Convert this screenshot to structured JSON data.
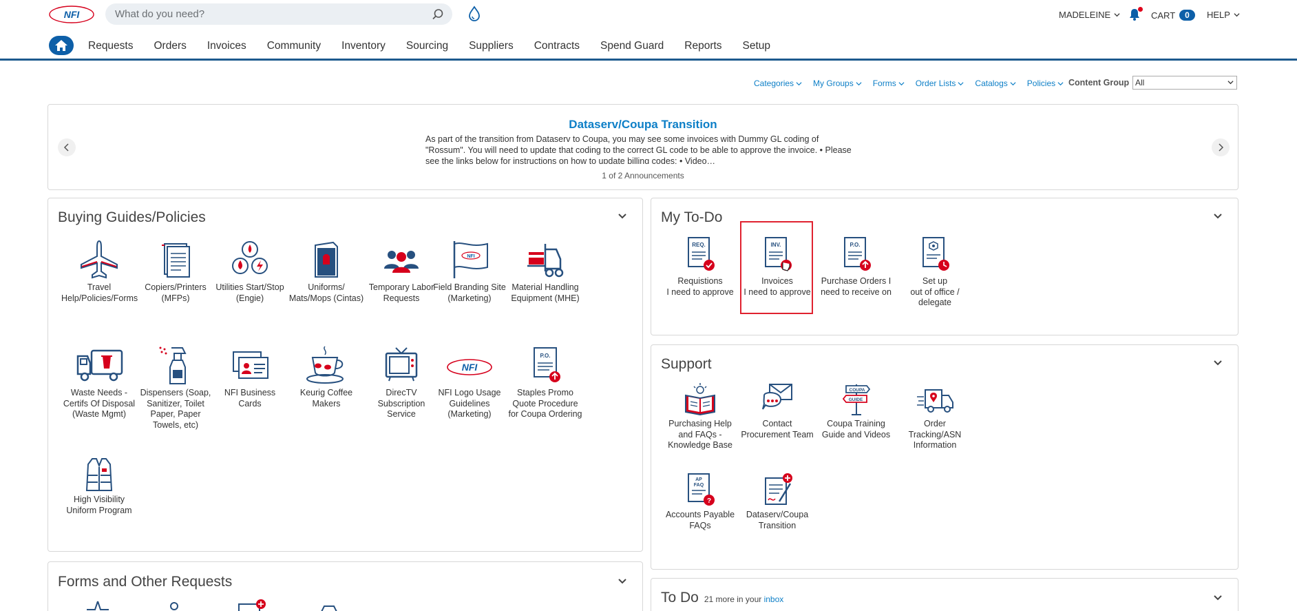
{
  "header": {
    "logo_text": "NFI",
    "search_placeholder": "What do you need?",
    "user_label": "MADELEINE",
    "cart_label": "CART",
    "cart_count": "0",
    "help_label": "HELP"
  },
  "nav": {
    "items": [
      "Requests",
      "Orders",
      "Invoices",
      "Community",
      "Inventory",
      "Sourcing",
      "Suppliers",
      "Contracts",
      "Spend Guard",
      "Reports",
      "Setup"
    ]
  },
  "subnav": {
    "items": [
      "Categories",
      "My Groups",
      "Forms",
      "Order Lists",
      "Catalogs",
      "Policies"
    ],
    "content_group_label": "Content Group",
    "content_group_value": "All"
  },
  "announcement": {
    "title": "Dataserv/Coupa Transition",
    "body": "As part of the transition from Dataserv to Coupa, you may see some invoices with Dummy GL coding of \"Rossum\". You will need to update that coding to the correct GL code to be able to approve the invoice. • Please see the links below for instructions on how to update billing codes: • Video…",
    "counter": "1 of 2 Announcements"
  },
  "buying_guides": {
    "title": "Buying Guides/Policies",
    "tiles": [
      "Travel Help/Policies/Forms",
      "Copiers/Printers (MFPs)",
      "Utilities Start/Stop (Engie)",
      "Uniforms/ Mats/Mops (Cintas)",
      "Temporary Labor Requests",
      "Field Branding Site (Marketing)",
      "Material Handling Equipment (MHE)",
      "Waste Needs - Certifs Of Disposal (Waste Mgmt)",
      "Dispensers (Soap, Sanitizer, Toilet Paper, Paper Towels, etc)",
      "NFI Business Cards",
      "Keurig Coffee Makers",
      "DirecTV Subscription Service",
      "NFI Logo Usage Guidelines (Marketing)",
      "Staples Promo Quote Procedure for Coupa Ordering",
      "High Visibility Uniform Program"
    ]
  },
  "my_todo": {
    "title": "My To-Do",
    "tiles": [
      {
        "label_1": "Requistions",
        "label_2": "I need to approve",
        "doc_text": "REQ."
      },
      {
        "label_1": "Invoices",
        "label_2": "I need to approve",
        "doc_text": "INV."
      },
      {
        "label_1": "Purchase Orders I",
        "label_2": "need to receive on",
        "doc_text": "P.O."
      },
      {
        "label_1": "Set up",
        "label_2": "out of office / delegate",
        "doc_text": ""
      }
    ]
  },
  "support": {
    "title": "Support",
    "tiles": [
      "Purchasing Help and FAQs - Knowledge Base",
      "Contact Procurement Team",
      "Coupa Training Guide and Videos",
      "Order Tracking/ASN Information",
      "Accounts Payable FAQs",
      "Dataserv/Coupa Transition"
    ],
    "guide_sign_top": "COUPA",
    "guide_sign_bottom": "GUIDE",
    "ap_doc_text_1": "AP",
    "ap_doc_text_2": "FAQ"
  },
  "forms": {
    "title": "Forms and Other Requests"
  },
  "todo": {
    "title": "To Do",
    "more_text": "21 more in your",
    "inbox_link": "inbox"
  },
  "colors": {
    "brand_blue": "#0d5fa8",
    "link_blue": "#0d7fc7",
    "accent_red": "#d6001c",
    "icon_navy": "#27507f",
    "highlight_red": "#e0212f"
  }
}
